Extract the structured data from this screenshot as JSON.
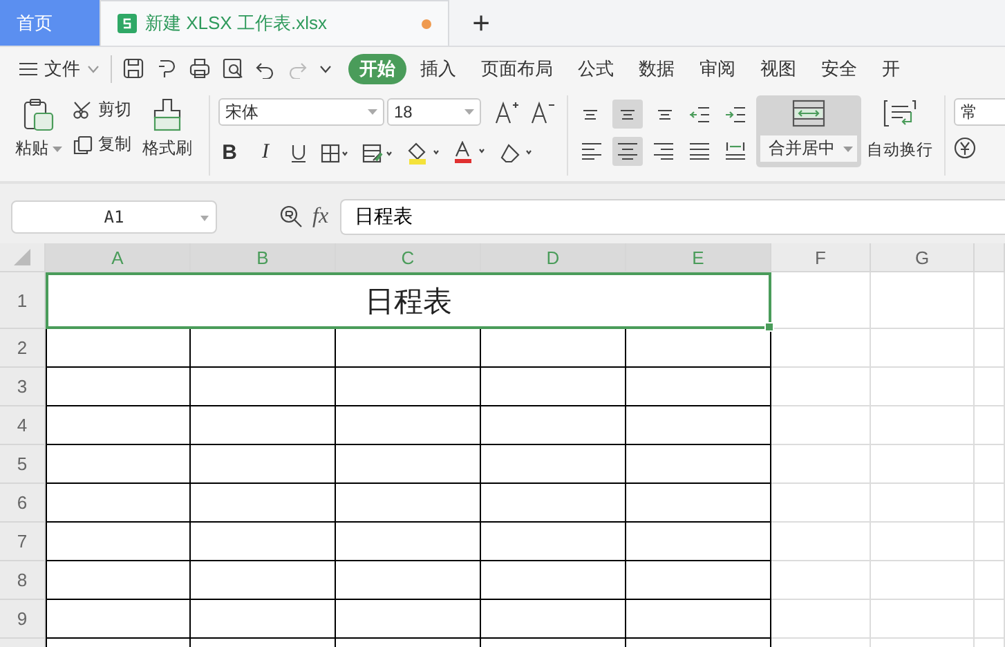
{
  "tabs": [
    {
      "kind": "home",
      "label": "首页",
      "selected": false
    },
    {
      "kind": "doc",
      "label": "新建 XLSX 工作表.xlsx",
      "selected": true,
      "modified": true
    }
  ],
  "new_tab": "+",
  "menu": {
    "file": "文件"
  },
  "ribbon_tabs": [
    {
      "label": "开始",
      "selected": true
    },
    {
      "label": "插入",
      "selected": false
    },
    {
      "label": "页面布局",
      "selected": false
    },
    {
      "label": "公式",
      "selected": false
    },
    {
      "label": "数据",
      "selected": false
    },
    {
      "label": "审阅",
      "selected": false
    },
    {
      "label": "视图",
      "selected": false
    },
    {
      "label": "安全",
      "selected": false
    },
    {
      "label": "开",
      "selected": false
    }
  ],
  "ribbon": {
    "paste": "粘贴",
    "cut": "剪切",
    "copy": "复制",
    "format_painter": "格式刷",
    "font_name": "宋体",
    "font_size": "18",
    "bold": "B",
    "italic": "I",
    "alignment": [
      {
        "kind": "top",
        "selected": false
      },
      {
        "kind": "middle",
        "selected": true
      },
      {
        "kind": "bottom",
        "selected": false
      },
      {
        "kind": "outdent",
        "selected": false
      },
      {
        "kind": "indent",
        "selected": false
      },
      {
        "kind": "left",
        "selected": false
      },
      {
        "kind": "center",
        "selected": true
      },
      {
        "kind": "right",
        "selected": false
      },
      {
        "kind": "justify",
        "selected": false
      },
      {
        "kind": "distribute",
        "selected": false
      }
    ],
    "merge": {
      "label": "合并居中",
      "selected": true
    },
    "wrap": "自动换行",
    "number_format": "常"
  },
  "formula_bar": {
    "cell_ref": "A1",
    "fx": "fx",
    "content": "日程表"
  },
  "sheet": {
    "columns": [
      {
        "label": "A",
        "selected": true
      },
      {
        "label": "B",
        "selected": true
      },
      {
        "label": "C",
        "selected": true
      },
      {
        "label": "D",
        "selected": true
      },
      {
        "label": "E",
        "selected": true
      },
      {
        "label": "F",
        "selected": false
      },
      {
        "label": "G",
        "selected": false
      }
    ],
    "rows": [
      "1",
      "2",
      "3",
      "4",
      "5",
      "6",
      "7",
      "8",
      "9"
    ],
    "merged_cell": {
      "text": "日程表",
      "selected": true
    }
  }
}
